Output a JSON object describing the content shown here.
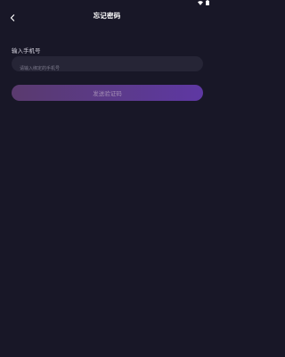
{
  "status_bar": {
    "icons": [
      "wifi-icon",
      "battery-icon"
    ]
  },
  "nav": {
    "title": "忘记密码",
    "back_icon": "chevron-left-icon"
  },
  "form": {
    "phone_label": "输入手机号",
    "phone_placeholder": "请输入绑定的手机号",
    "phone_value": "",
    "send_button_label": "发送验证码"
  },
  "colors": {
    "background": "#181727",
    "input_background": "#262536",
    "button_gradient_start": "#5a3a6e",
    "button_gradient_end": "#5e38a3",
    "button_text": "#a58fb6"
  }
}
